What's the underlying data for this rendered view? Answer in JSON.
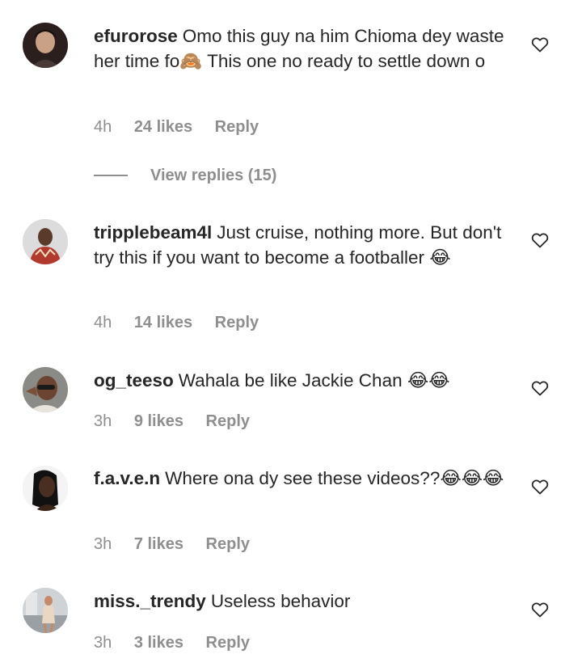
{
  "comments": [
    {
      "username": "efurorose",
      "text": "Omo this guy na him Chioma dey waste her time fo🙈 This one no ready to settle down o",
      "time": "4h",
      "likes": "24 likes",
      "reply": "Reply",
      "avatar_icon": "user-avatar-icon"
    },
    {
      "username": "tripplebeam4l",
      "text": "Just cruise, nothing more. But don't try this if you want to become a footballer 😂",
      "time": "4h",
      "likes": "14 likes",
      "reply": "Reply",
      "avatar_icon": "user-avatar-icon"
    },
    {
      "username": "og_teeso",
      "text": "Wahala be like Jackie Chan 😂😂",
      "time": "3h",
      "likes": "9 likes",
      "reply": "Reply",
      "avatar_icon": "user-avatar-icon"
    },
    {
      "username": "f.a.v.e.n",
      "text": "Where ona dy see these videos??😂😂😂",
      "time": "3h",
      "likes": "7 likes",
      "reply": "Reply",
      "avatar_icon": "user-avatar-icon"
    },
    {
      "username": "miss._trendy",
      "text": "Useless behavior",
      "time": "3h",
      "likes": "3 likes",
      "reply": "Reply",
      "avatar_icon": "user-avatar-icon"
    }
  ],
  "view_replies": {
    "label": "View replies (15)"
  },
  "icons": {
    "like": "heart-outline-icon"
  },
  "colors": {
    "text": "#262626",
    "secondary": "#8e8e8e",
    "background": "#ffffff"
  }
}
